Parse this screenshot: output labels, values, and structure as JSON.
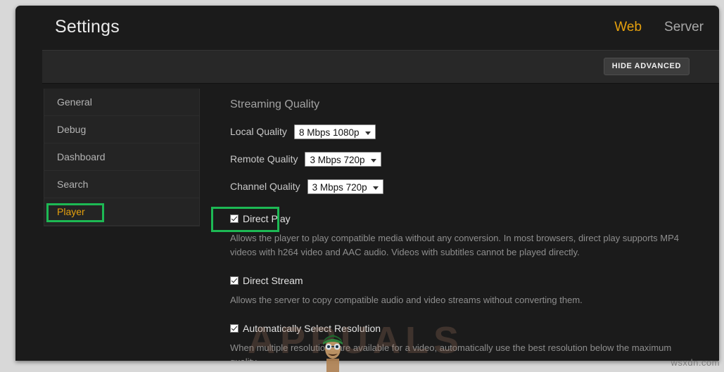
{
  "window": {
    "title": "Settings"
  },
  "header": {
    "tabs": [
      {
        "label": "Web",
        "active": true
      },
      {
        "label": "Server",
        "active": false
      }
    ],
    "advanced_button": "HIDE ADVANCED"
  },
  "sidebar": {
    "items": [
      {
        "label": "General",
        "selected": false
      },
      {
        "label": "Debug",
        "selected": false
      },
      {
        "label": "Dashboard",
        "selected": false
      },
      {
        "label": "Search",
        "selected": false
      },
      {
        "label": "Player",
        "selected": true
      }
    ]
  },
  "main": {
    "section_title": "Streaming Quality",
    "quality_fields": [
      {
        "label": "Local Quality",
        "value": "8 Mbps 1080p"
      },
      {
        "label": "Remote Quality",
        "value": "3 Mbps 720p"
      },
      {
        "label": "Channel Quality",
        "value": "3 Mbps 720p"
      }
    ],
    "options": [
      {
        "label": "Direct Play",
        "checked": true,
        "description": "Allows the player to play compatible media without any conversion. In most browsers, direct play supports MP4 videos with h264 video and AAC audio. Videos with subtitles cannot be played directly."
      },
      {
        "label": "Direct Stream",
        "checked": true,
        "description": "Allows the server to copy compatible audio and video streams without converting them."
      },
      {
        "label": "Automatically Select Resolution",
        "checked": true,
        "description": "When multiple resolutions are available for a video, automatically use the best resolution below the maximum quality."
      }
    ]
  },
  "annotations": {
    "color": "#1db954",
    "targets": [
      "Player",
      "Direct Play"
    ]
  },
  "watermark": {
    "text": "APPUALS",
    "credit": "wsxdn.com"
  },
  "colors": {
    "accent": "#e5a00d",
    "window_bg": "#1b1b1b",
    "panel_bg": "#242424",
    "annotation_green": "#1db954"
  }
}
